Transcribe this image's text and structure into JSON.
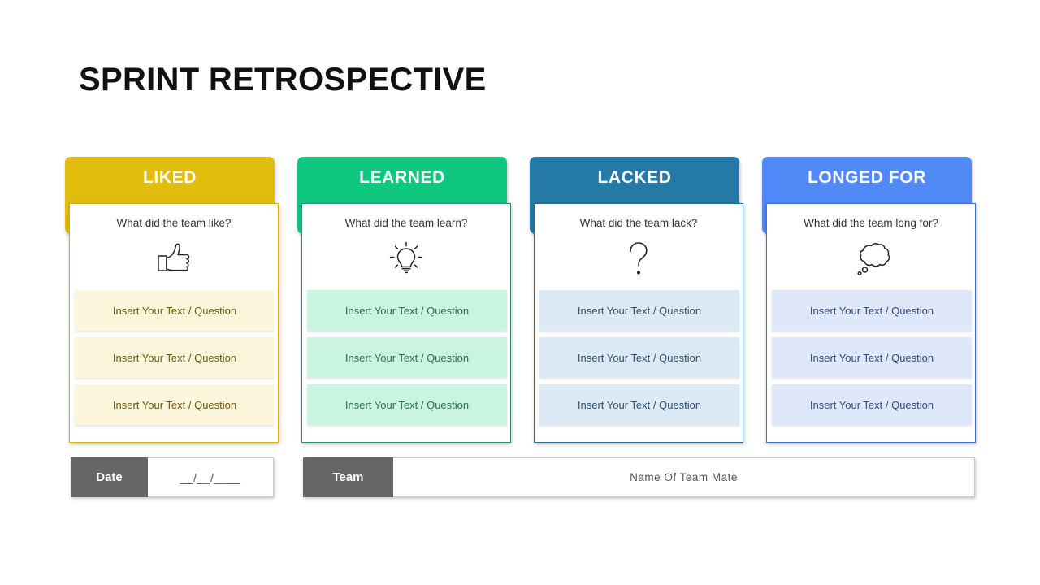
{
  "page_title": "SPRINT RETROSPECTIVE",
  "cards": [
    {
      "title": "LIKED",
      "question": "What did the team like?",
      "icon": "thumbs-up-icon",
      "header_color": "#E0BC0C",
      "border_color": "#D4B30C",
      "row_color": "#FCF6DC",
      "row_text_color": "#6B5A10",
      "rows": [
        "Insert Your Text / Question",
        "Insert Your Text / Question",
        "Insert Your Text / Question"
      ]
    },
    {
      "title": "LEARNED",
      "question": "What did the team learn?",
      "icon": "lightbulb-icon",
      "header_color": "#0FC77F",
      "border_color": "#2E8E73",
      "row_color": "#C9F5E0",
      "row_text_color": "#2F6B57",
      "rows": [
        "Insert Your Text / Question",
        "Insert Your Text / Question",
        "Insert Your Text / Question"
      ]
    },
    {
      "title": "LACKED",
      "question": "What did the team lack?",
      "icon": "question-mark-icon",
      "header_color": "#2479A5",
      "border_color": "#2C6E92",
      "row_color": "#DCEAF5",
      "row_text_color": "#2F4F69",
      "rows": [
        "Insert Your Text / Question",
        "Insert Your Text / Question",
        "Insert Your Text / Question"
      ]
    },
    {
      "title": "LONGED FOR",
      "question": "What did the team long for?",
      "icon": "thought-cloud-icon",
      "header_color": "#5189F7",
      "border_color": "#3D6FD6",
      "row_color": "#DFE7FB",
      "row_text_color": "#36497A",
      "rows": [
        "Insert Your Text / Question",
        "Insert Your Text / Question",
        "Insert Your Text / Question"
      ]
    }
  ],
  "footer": {
    "date_label": "Date",
    "date_value": "__/__/____",
    "team_label": "Team",
    "team_value": "Name Of Team Mate"
  }
}
